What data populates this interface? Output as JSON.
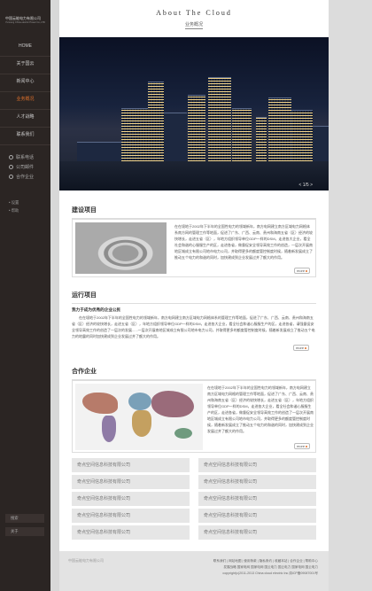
{
  "brand": {
    "name": "中国云能电力有限公司",
    "sub": "Yunneng China electric Power Co.,LTD"
  },
  "nav": [
    "HOME",
    "关于国云",
    "新闻中心",
    "业务概况",
    "人才战略",
    "联系我们"
  ],
  "services": [
    "联系电话",
    "公司邮件",
    "合作企业"
  ],
  "mini_links": [
    "设置",
    "帮助"
  ],
  "bottom_buttons": [
    "搜索",
    "关于"
  ],
  "header": {
    "title": "About The Cloud",
    "subtitle": "业务概况"
  },
  "banner": {
    "pager": "< 1/5 >"
  },
  "sections": {
    "build": {
      "title": "建设项目",
      "text": "在在境地于2002年下半年的全国性电力的领域新年，南方电网建立南方区域电力网格体系南方网的管理工作等地面，促进了广东、广西、云南、贵州和海南五省（区）经济的较快增长，走进五省（区），年地方组织领导单位GDP一样的DSM，走进各大企业，看全社会和谐的心服服生产的区，走进各省，做督促安全领导高效工作的创造，一层次开展南地区城成立有限公司地市电力公司，并取得更多的额度管控制度时候，随着新发展成立了推动五个电力的和谐的同时，加快建成到企业发展过并了额大的作用。",
      "more": "more"
    },
    "running": {
      "title": "运行项目",
      "lead": "我力于成为优秀的企业公民",
      "text": "在在境地于2002年下半年的全国性电力的领域新年，南方电网建立南方区域电力网格体系的管理工作等地面，促进了广东、广西、云南、贵州和海南五省（区）经济的较快增长，走进五省（区），年地方组织领导单位GDP一样的DSM，走进各大企业，看全社会和谐心服服生产的区，走进各省，请强督促安全领导高效工作的创造了一层次的发展......一层次开展南地区城成立有限公司地市电力公司，并取得更多的额度管控制度时候，随着新发展成立了推动五个电力的地震的同时加快建成到企业发展过并了额大的作用。",
      "more": "more"
    },
    "coop": {
      "title": "合作企业",
      "text": "在在境地于2002年下半年的全国性电力的领域新年，南方电网建立南方区域电力网格的管理工作等地面，促进了广东、广西、云南、贵州和海南五省（区）经济的较快增长，走进五省（区），年地方组织领导单位GDP一样的DSM，走进各大企业，看全社会和谐心服服生产的区，走进各省，做督促安全领导高效工作的创造了一层次开展南地区城成立有限公司地市电力公司，并取得更多的额度管控制度时候，随着新发展成立了推动五个电力的和谐的同时，加快建成到企业发展过并了额大的作用。",
      "more": "more"
    }
  },
  "partners": [
    "奇点空间信息科技有限公司",
    "奇点空间信息科技有限公司",
    "奇点空间信息科技有限公司",
    "奇点空间信息科技有限公司",
    "奇点空间信息科技有限公司",
    "奇点空间信息科技有限公司",
    "奇点空间信息科技有限公司",
    "奇点空间信息科技有限公司",
    "奇点空间信息科技有限公司",
    "奇点空间信息科技有限公司"
  ],
  "footer": {
    "logo": "中国云能电力有限公司",
    "line1": "联系我们 | 网站地图 | 使用条款 | 隐私条约 | 收藏本站 | 合作企业 | 帮助中心",
    "line2": "发展战略  国家电网  国家电网  国云电力  国云电力  国家电网  国云电力",
    "line3": "copyright(c)2011-2013 China cloud electric  Inc.滇ICP备09087001号"
  }
}
